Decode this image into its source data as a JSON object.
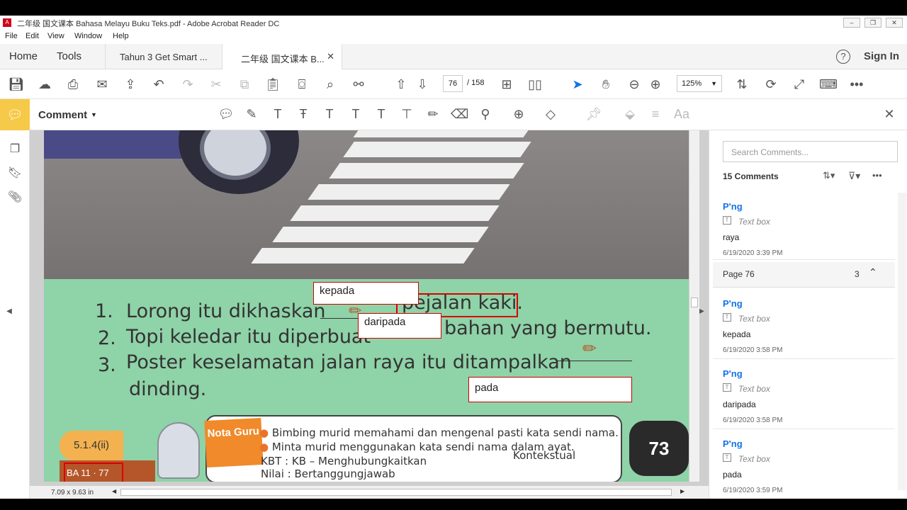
{
  "window": {
    "title": "二年级 国文课本 Bahasa Melayu Buku Teks.pdf - Adobe Acrobat Reader DC"
  },
  "menu": [
    "File",
    "Edit",
    "View",
    "Window",
    "Help"
  ],
  "tabs": {
    "home": "Home",
    "tools": "Tools",
    "doc1": "Tahun 3 Get Smart ...",
    "doc2": "二年级 国文课本 B..."
  },
  "signin": "Sign In",
  "toolbar": {
    "page_current": "76",
    "page_total": "/ 158",
    "zoom": "125%"
  },
  "commentbar": {
    "label": "Comment"
  },
  "document": {
    "lines": [
      {
        "num": "1.",
        "pre": "Lorong itu dikhaskan",
        "post": "pejalan kaki."
      },
      {
        "num": "2.",
        "pre": "Topi keledar itu diperbuat",
        "post": "bahan yang bermutu."
      },
      {
        "num": "3.",
        "pre": "Poster keselamatan jalan raya itu ditampalkan",
        "post": ""
      },
      {
        "num": "",
        "pre": "dinding.",
        "post": ""
      }
    ],
    "textboxes": {
      "kepada": "kepada",
      "daripada": "daripada",
      "pada": "pada"
    },
    "tag": "5.1.4(ii)",
    "tag2": "BA 11 · 77",
    "nota": "Nota Guru",
    "bullets": [
      "Bimbing murid memahami dan mengenal pasti kata sendi nama.",
      "Minta murid menggunakan kata sendi nama dalam ayat."
    ],
    "kbt": "KBT : KB – Menghubungkaitkan",
    "kontekstual": "Kontekstual",
    "nilai": "Nilai : Bertanggungjawab",
    "page_number": "73"
  },
  "statusbar": {
    "size": "7.09 x 9.63 in"
  },
  "comments_panel": {
    "search_placeholder": "Search Comments...",
    "count": "15 Comments",
    "page_group": {
      "label": "Page 76",
      "count": "3"
    },
    "items": [
      {
        "author": "P'ng",
        "type": "Text box",
        "text": "raya",
        "date": "6/19/2020  3:39 PM"
      },
      {
        "author": "P'ng",
        "type": "Text box",
        "text": "kepada",
        "date": "6/19/2020  3:58 PM"
      },
      {
        "author": "P'ng",
        "type": "Text box",
        "text": "daripada",
        "date": "6/19/2020  3:58 PM"
      },
      {
        "author": "P'ng",
        "type": "Text box",
        "text": "pada",
        "date": "6/19/2020  3:59 PM"
      }
    ]
  }
}
